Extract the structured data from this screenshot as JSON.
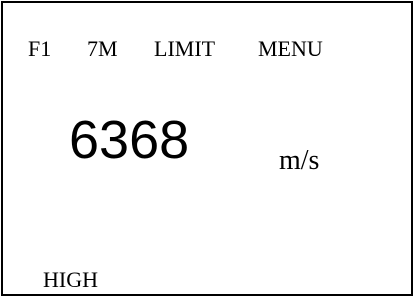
{
  "menu_bar": {
    "items": [
      {
        "label": "F1"
      },
      {
        "label": "7M"
      },
      {
        "label": "LIMIT"
      },
      {
        "label": "MENU"
      }
    ]
  },
  "reading": {
    "value": "6368",
    "unit": "m/s"
  },
  "status": {
    "text": "HIGH"
  },
  "colors": {
    "foreground": "#000000",
    "background": "#ffffff"
  }
}
